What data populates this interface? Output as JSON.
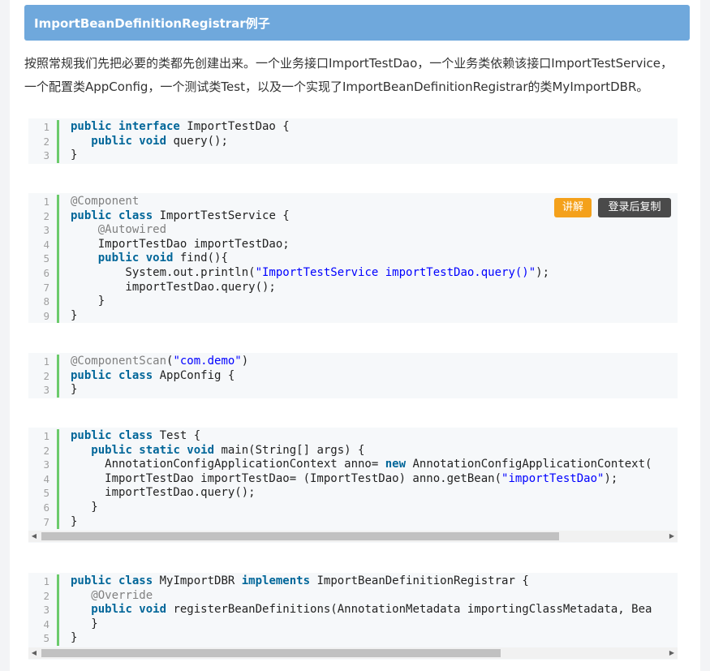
{
  "header": {
    "title": "ImportBeanDefinitionRegistrar例子"
  },
  "intro": {
    "text": "按照常规我们先把必要的类都先创建出来。一个业务接口ImportTestDao，一个业务类依赖该接口ImportTestService，一个配置类AppConfig，一个测试类Test，以及一个实现了ImportBeanDefinitionRegistrar的类MyImportDBR。"
  },
  "toolbar": {
    "explain_label": "讲解",
    "copy_label": "登录后复制"
  },
  "colors": {
    "header_bg": "#6fa8dc",
    "gutter_border": "#6ccb6c",
    "keyword": "#006699",
    "annotation": "#808080",
    "string": "#0000ff",
    "explain_button": "#f4a11b",
    "copy_button": "#4a4a4a"
  },
  "code_blocks": [
    {
      "lines": [
        [
          [
            "kw",
            "public interface"
          ],
          [
            "t",
            " ImportTestDao {"
          ]
        ],
        [
          [
            "t",
            "   "
          ],
          [
            "kw",
            "public void"
          ],
          [
            "t",
            " query();"
          ]
        ],
        [
          [
            "t",
            "}"
          ]
        ]
      ]
    },
    {
      "lines": [
        [
          [
            "an",
            "@Component"
          ]
        ],
        [
          [
            "kw",
            "public class"
          ],
          [
            "t",
            " ImportTestService {"
          ]
        ],
        [
          [
            "t",
            "    "
          ],
          [
            "an",
            "@Autowired"
          ]
        ],
        [
          [
            "t",
            "    ImportTestDao importTestDao;"
          ]
        ],
        [
          [
            "t",
            "    "
          ],
          [
            "kw",
            "public void"
          ],
          [
            "t",
            " find(){"
          ]
        ],
        [
          [
            "t",
            "        System.out.println("
          ],
          [
            "st",
            "\"ImportTestService importTestDao.query()\""
          ],
          [
            "t",
            ");"
          ]
        ],
        [
          [
            "t",
            "        importTestDao.query();"
          ]
        ],
        [
          [
            "t",
            "    }"
          ]
        ],
        [
          [
            "t",
            "}"
          ]
        ]
      ]
    },
    {
      "lines": [
        [
          [
            "an",
            "@ComponentScan"
          ],
          [
            "t",
            "("
          ],
          [
            "st",
            "\"com.demo\""
          ],
          [
            "t",
            ")"
          ]
        ],
        [
          [
            "kw",
            "public class"
          ],
          [
            "t",
            " AppConfig {"
          ]
        ],
        [
          [
            "t",
            "}"
          ]
        ]
      ]
    },
    {
      "lines": [
        [
          [
            "kw",
            "public class"
          ],
          [
            "t",
            " Test {"
          ]
        ],
        [
          [
            "t",
            "   "
          ],
          [
            "kw",
            "public static void"
          ],
          [
            "t",
            " main(String[] args) {"
          ]
        ],
        [
          [
            "t",
            "     AnnotationConfigApplicationContext anno= "
          ],
          [
            "kw",
            "new"
          ],
          [
            "t",
            " AnnotationConfigApplicationContext("
          ]
        ],
        [
          [
            "t",
            "     ImportTestDao importTestDao= (ImportTestDao) anno.getBean("
          ],
          [
            "st",
            "\"importTestDao\""
          ],
          [
            "t",
            ");"
          ]
        ],
        [
          [
            "t",
            "     importTestDao.query();"
          ]
        ],
        [
          [
            "t",
            "   }"
          ]
        ],
        [
          [
            "t",
            "}"
          ]
        ]
      ]
    },
    {
      "lines": [
        [
          [
            "kw",
            "public class"
          ],
          [
            "t",
            " MyImportDBR "
          ],
          [
            "kw",
            "implements"
          ],
          [
            "t",
            " ImportBeanDefinitionRegistrar {"
          ]
        ],
        [
          [
            "t",
            "   "
          ],
          [
            "an",
            "@Override"
          ]
        ],
        [
          [
            "t",
            "   "
          ],
          [
            "kw",
            "public void"
          ],
          [
            "t",
            " registerBeanDefinitions(AnnotationMetadata importingClassMetadata, Bea"
          ]
        ],
        [
          [
            "t",
            "   }"
          ]
        ],
        [
          [
            "t",
            "}"
          ]
        ]
      ]
    }
  ]
}
